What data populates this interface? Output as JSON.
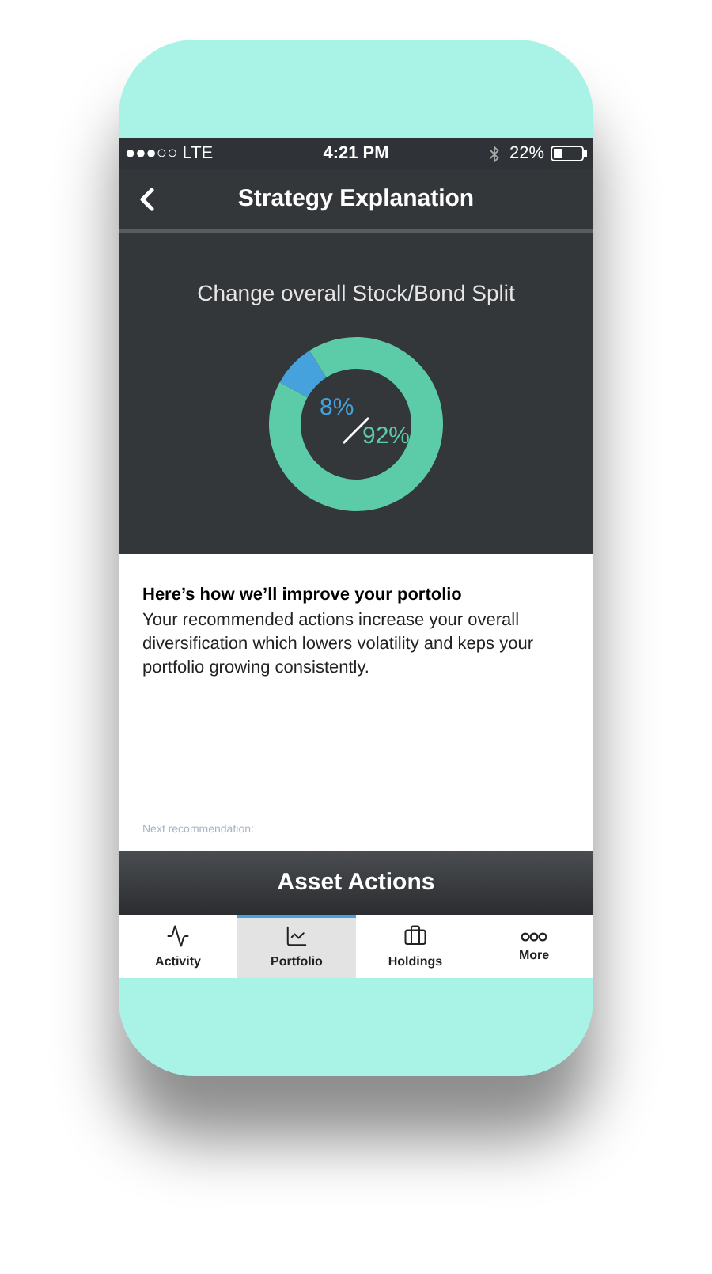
{
  "status_bar": {
    "carrier": "●●●○○ LTE",
    "time": "4:21 PM",
    "battery": "22%"
  },
  "nav": {
    "title": "Strategy Explanation"
  },
  "split": {
    "title": "Change overall Stock/Bond Split",
    "chart_data": {
      "type": "donut",
      "values": [
        8,
        92
      ]
    },
    "center_labels": [
      "8%",
      "92%"
    ]
  },
  "explanation": {
    "heading": "Here’s how we’ll improve your portolio",
    "body": "Your recommended actions increase your overall diversification which lowers volatility and keps your portfolio growing consistently.",
    "next_label": "Next recommendation:"
  },
  "action_bar": {
    "title": "Asset Actions"
  },
  "tabs": [
    {
      "label": "Activity",
      "kind": "activity",
      "selected": false
    },
    {
      "label": "Portfolio",
      "kind": "portfolio",
      "selected": true
    },
    {
      "label": "Holdings",
      "kind": "holdings",
      "selected": false
    },
    {
      "label": "More",
      "kind": "more",
      "selected": false
    }
  ]
}
